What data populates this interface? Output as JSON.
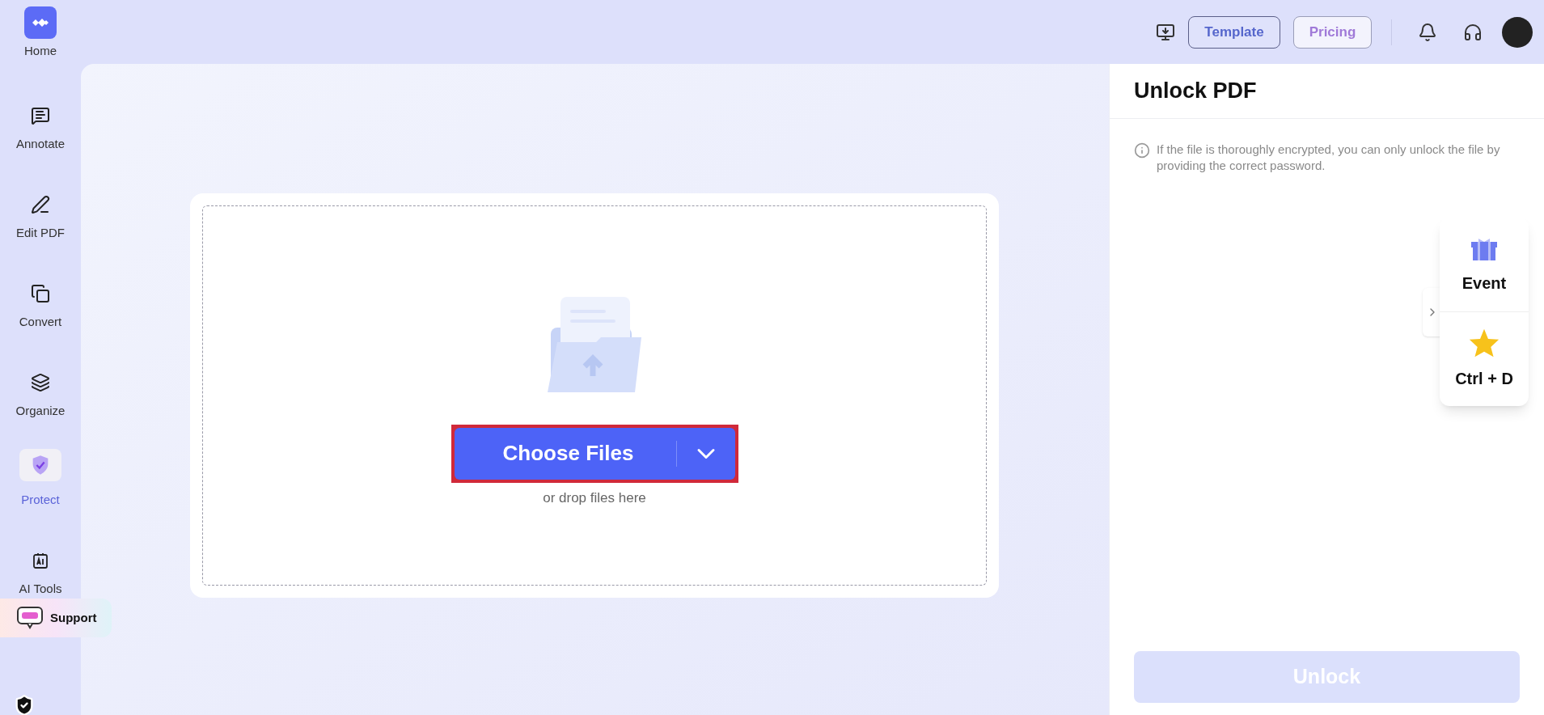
{
  "sidebar": {
    "home": {
      "label": "Home"
    },
    "items": [
      {
        "label": "Annotate",
        "kind": "annotate",
        "selected": false
      },
      {
        "label": "Edit PDF",
        "kind": "edit",
        "selected": false
      },
      {
        "label": "Convert",
        "kind": "convert",
        "selected": false
      },
      {
        "label": "Organize",
        "kind": "organize",
        "selected": false
      },
      {
        "label": "Protect",
        "kind": "protect",
        "selected": true
      },
      {
        "label": "AI Tools",
        "kind": "ai",
        "selected": false
      }
    ],
    "support": {
      "label": "Support"
    }
  },
  "top_bar": {
    "buttons": [
      {
        "label": "Template",
        "kind": "outline"
      },
      {
        "label": "Pricing",
        "kind": "light"
      }
    ]
  },
  "upload": {
    "button": {
      "label": "Choose Files",
      "highlighted": true
    },
    "hint": "or drop files here"
  },
  "panel": {
    "title": "Unlock PDF",
    "note": "If the file is thoroughly encrypted, you can only unlock the file by providing the correct password.",
    "action": {
      "label": "Unlock",
      "disabled": true
    }
  },
  "float_menu": [
    {
      "label": "Event",
      "kind": "gift"
    },
    {
      "label": "Ctrl + D",
      "kind": "star"
    }
  ]
}
